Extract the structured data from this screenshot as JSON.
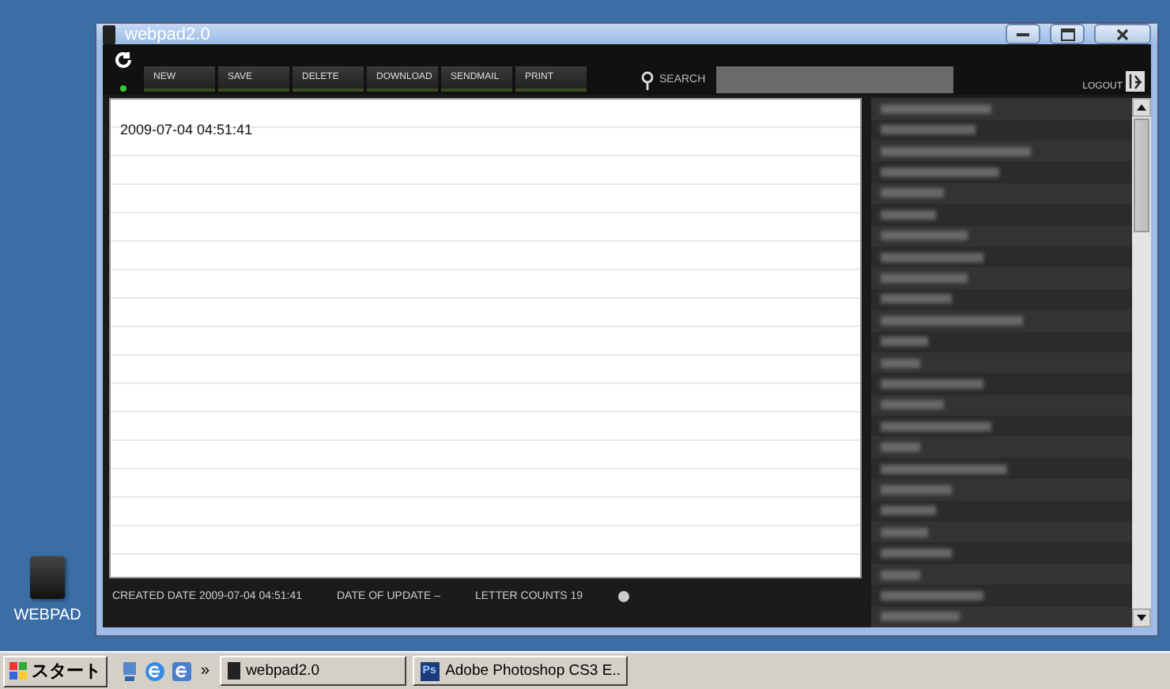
{
  "window": {
    "title": "webpad2.0"
  },
  "toolbar": {
    "buttons": [
      "NEW",
      "SAVE",
      "DELETE",
      "DOWNLOAD",
      "SENDMAIL",
      "PRINT"
    ],
    "search_label": "SEARCH",
    "logout": "LOGOUT"
  },
  "editor": {
    "value": "2009-07-04 04:51:41"
  },
  "status_bar": {
    "created_label": "CREATED DATE",
    "created": "2009-07-04 04:51:41",
    "update_label": "DATE OF UPDATE",
    "update": "–",
    "count_label": "LETTER COUNTS",
    "count": "19"
  },
  "desktop_icons": [
    {
      "label": "WEBPAD"
    }
  ],
  "taskbar": {
    "start": "スタート",
    "more": "»",
    "tasks": [
      {
        "label": "webpad2.0"
      },
      {
        "label": "Adobe Photoshop CS3 E..",
        "icon_text": "Ps"
      }
    ]
  }
}
